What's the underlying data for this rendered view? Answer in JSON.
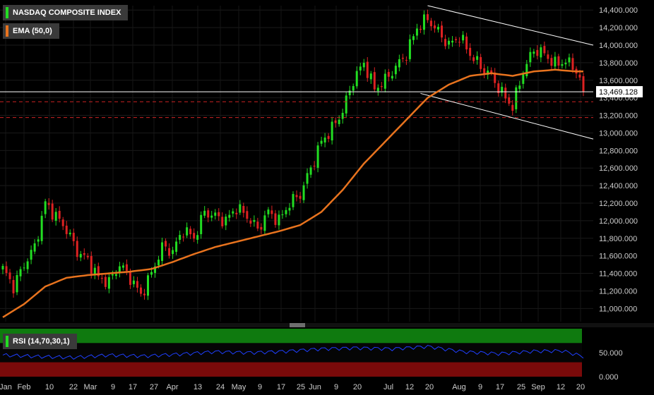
{
  "legend": {
    "main_title": "NASDAQ COMPOSITE INDEX",
    "main_color": "#22dd22",
    "ema_label": "EMA (50,0)",
    "ema_color": "#e8731e",
    "rsi_label": "RSI (14,70,30,1)",
    "rsi_color": "#22dd22"
  },
  "chart_data": [
    {
      "type": "candlestick",
      "title": "NASDAQ COMPOSITE INDEX",
      "last_price": "13,469.128",
      "ylim": [
        10850,
        14450
      ],
      "y_ticks": [
        "11,000.000",
        "11,200.000",
        "11,400.000",
        "11,600.000",
        "11,800.000",
        "12,000.000",
        "12,200.000",
        "12,400.000",
        "12,600.000",
        "12,800.000",
        "13,000.000",
        "13,200.000",
        "13,400.000",
        "13,600.000",
        "13,800.000",
        "14,000.000",
        "14,200.000",
        "14,400.000"
      ],
      "x_ticks": [
        "Jan",
        "Feb",
        "10",
        "22",
        "Mar",
        "9",
        "17",
        "27",
        "Apr",
        "13",
        "24",
        "May",
        "9",
        "17",
        "25",
        "Jun",
        "9",
        "20",
        "Jul",
        "12",
        "20",
        "Aug",
        "9",
        "17",
        "25",
        "Sep",
        "12",
        "20"
      ],
      "close_anchors": [
        [
          0,
          11450
        ],
        [
          3,
          11250
        ],
        [
          6,
          11500
        ],
        [
          9,
          11700
        ],
        [
          12,
          12200
        ],
        [
          15,
          12050
        ],
        [
          18,
          11900
        ],
        [
          21,
          11650
        ],
        [
          24,
          11550
        ],
        [
          27,
          11350
        ],
        [
          30,
          11300
        ],
        [
          33,
          11500
        ],
        [
          36,
          11350
        ],
        [
          39,
          11150
        ],
        [
          42,
          11400
        ],
        [
          45,
          11700
        ],
        [
          48,
          11650
        ],
        [
          51,
          11900
        ],
        [
          54,
          11800
        ],
        [
          57,
          12100
        ],
        [
          60,
          12050
        ],
        [
          63,
          12000
        ],
        [
          66,
          12150
        ],
        [
          69,
          12050
        ],
        [
          72,
          11900
        ],
        [
          75,
          12100
        ],
        [
          78,
          12000
        ],
        [
          81,
          12200
        ],
        [
          84,
          12300
        ],
        [
          87,
          12600
        ],
        [
          90,
          12900
        ],
        [
          93,
          13050
        ],
        [
          96,
          13250
        ],
        [
          99,
          13600
        ],
        [
          102,
          13800
        ],
        [
          105,
          13500
        ],
        [
          108,
          13600
        ],
        [
          111,
          13750
        ],
        [
          114,
          13900
        ],
        [
          117,
          14200
        ],
        [
          120,
          14300
        ],
        [
          123,
          14150
        ],
        [
          126,
          14000
        ],
        [
          129,
          14100
        ],
        [
          132,
          13900
        ],
        [
          135,
          13750
        ],
        [
          138,
          13650
        ],
        [
          141,
          13450
        ],
        [
          144,
          13300
        ],
        [
          147,
          13700
        ],
        [
          150,
          13950
        ],
        [
          153,
          13900
        ],
        [
          156,
          13780
        ],
        [
          159,
          13820
        ],
        [
          162,
          13720
        ],
        [
          164,
          13469
        ]
      ],
      "ema": {
        "name": "EMA (50,0)",
        "anchors": [
          [
            0,
            10900
          ],
          [
            6,
            11050
          ],
          [
            12,
            11250
          ],
          [
            18,
            11350
          ],
          [
            24,
            11380
          ],
          [
            30,
            11400
          ],
          [
            36,
            11420
          ],
          [
            42,
            11450
          ],
          [
            48,
            11530
          ],
          [
            54,
            11620
          ],
          [
            60,
            11700
          ],
          [
            66,
            11760
          ],
          [
            72,
            11820
          ],
          [
            78,
            11880
          ],
          [
            84,
            11950
          ],
          [
            90,
            12100
          ],
          [
            96,
            12350
          ],
          [
            102,
            12650
          ],
          [
            108,
            12900
          ],
          [
            114,
            13150
          ],
          [
            120,
            13400
          ],
          [
            126,
            13550
          ],
          [
            132,
            13650
          ],
          [
            138,
            13680
          ],
          [
            144,
            13650
          ],
          [
            150,
            13700
          ],
          [
            156,
            13720
          ],
          [
            162,
            13700
          ]
        ]
      },
      "channel": {
        "upper": [
          [
            120,
            14450
          ],
          [
            168,
            14000
          ]
        ],
        "lower": [
          [
            118,
            13450
          ],
          [
            168,
            12930
          ]
        ]
      },
      "horizontal_lines": [
        {
          "price": 13469,
          "style": "solid",
          "color": "#ffffff"
        },
        {
          "price": 13355,
          "style": "dashed",
          "color": "#cc2222"
        },
        {
          "price": 13175,
          "style": "dashed",
          "color": "#cc2222"
        }
      ]
    },
    {
      "type": "line",
      "title": "RSI (14,70,30,1)",
      "ylim": [
        0,
        100
      ],
      "y_ticks": [
        "50.000",
        "0.000"
      ],
      "overbought": 70,
      "oversold": 30,
      "anchors": [
        [
          0,
          45
        ],
        [
          10,
          42
        ],
        [
          20,
          40
        ],
        [
          30,
          45
        ],
        [
          40,
          43
        ],
        [
          50,
          47
        ],
        [
          60,
          52
        ],
        [
          70,
          50
        ],
        [
          80,
          53
        ],
        [
          90,
          58
        ],
        [
          100,
          60
        ],
        [
          110,
          58
        ],
        [
          120,
          63
        ],
        [
          130,
          52
        ],
        [
          140,
          48
        ],
        [
          150,
          53
        ],
        [
          158,
          54
        ],
        [
          164,
          42
        ]
      ]
    }
  ]
}
